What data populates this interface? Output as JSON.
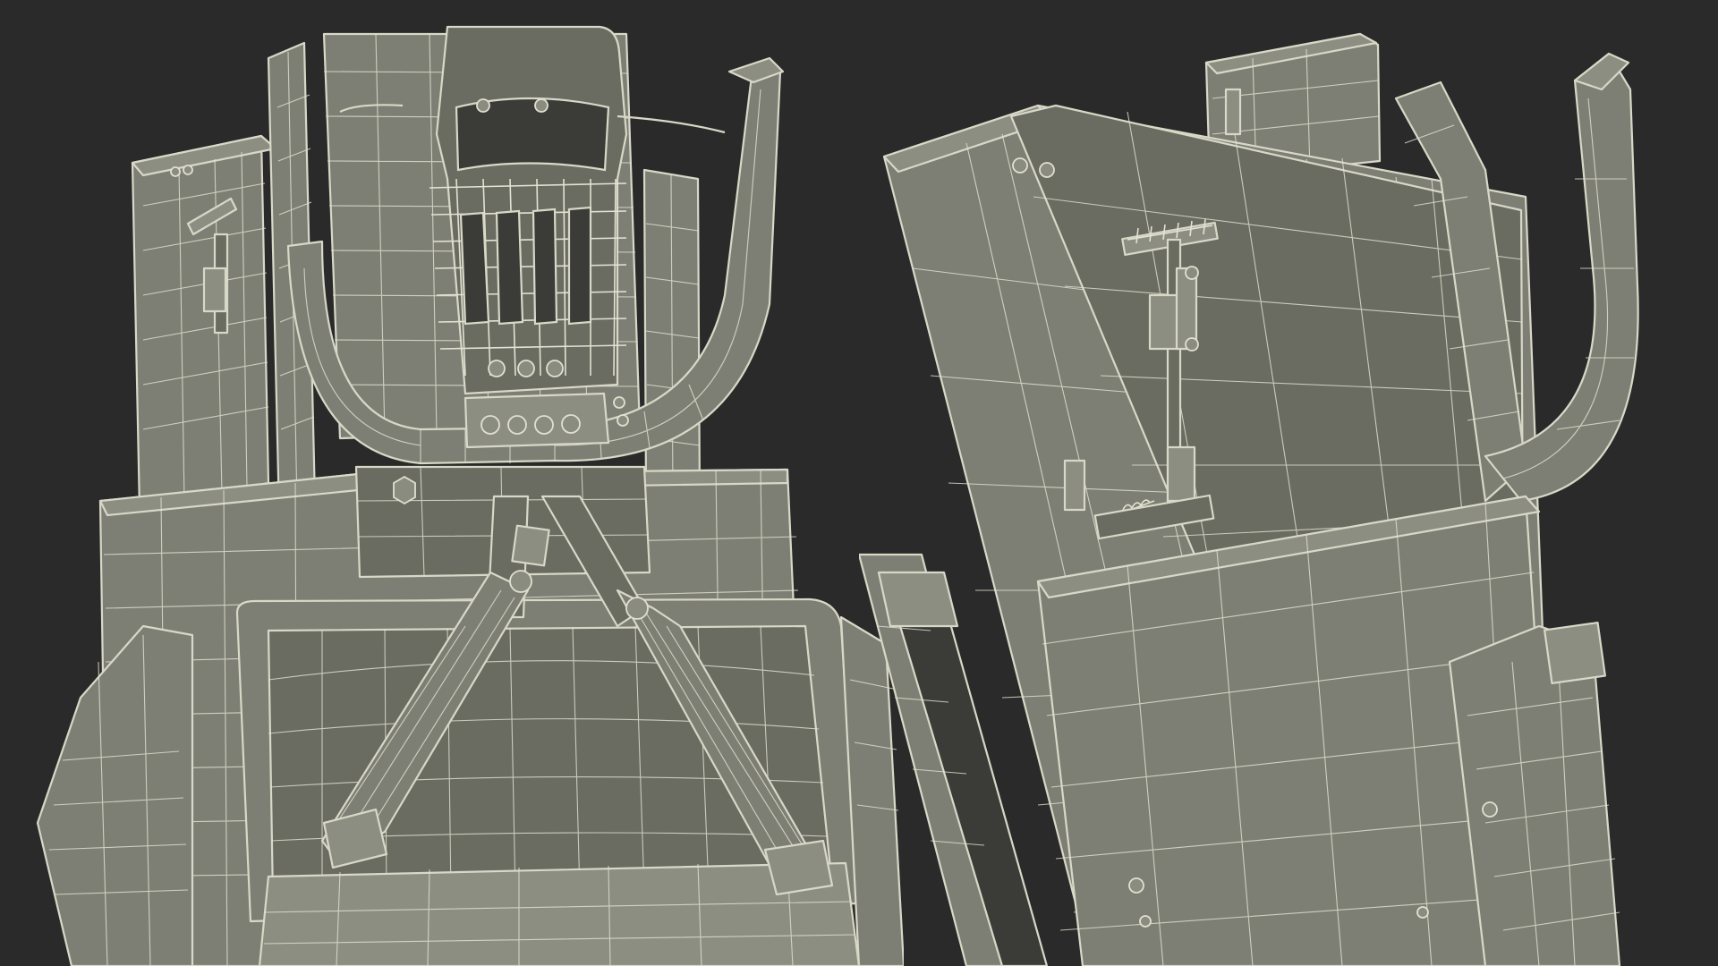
{
  "scene": {
    "background_color": "#2a2a2a",
    "model_color": "#7e7f74",
    "wireframe_color": "#d8d8c8",
    "render_style": "wireframe-over-shaded",
    "views": [
      {
        "id": "front",
        "subject": "ejection-seat-front"
      },
      {
        "id": "back",
        "subject": "ejection-seat-rear"
      }
    ]
  }
}
